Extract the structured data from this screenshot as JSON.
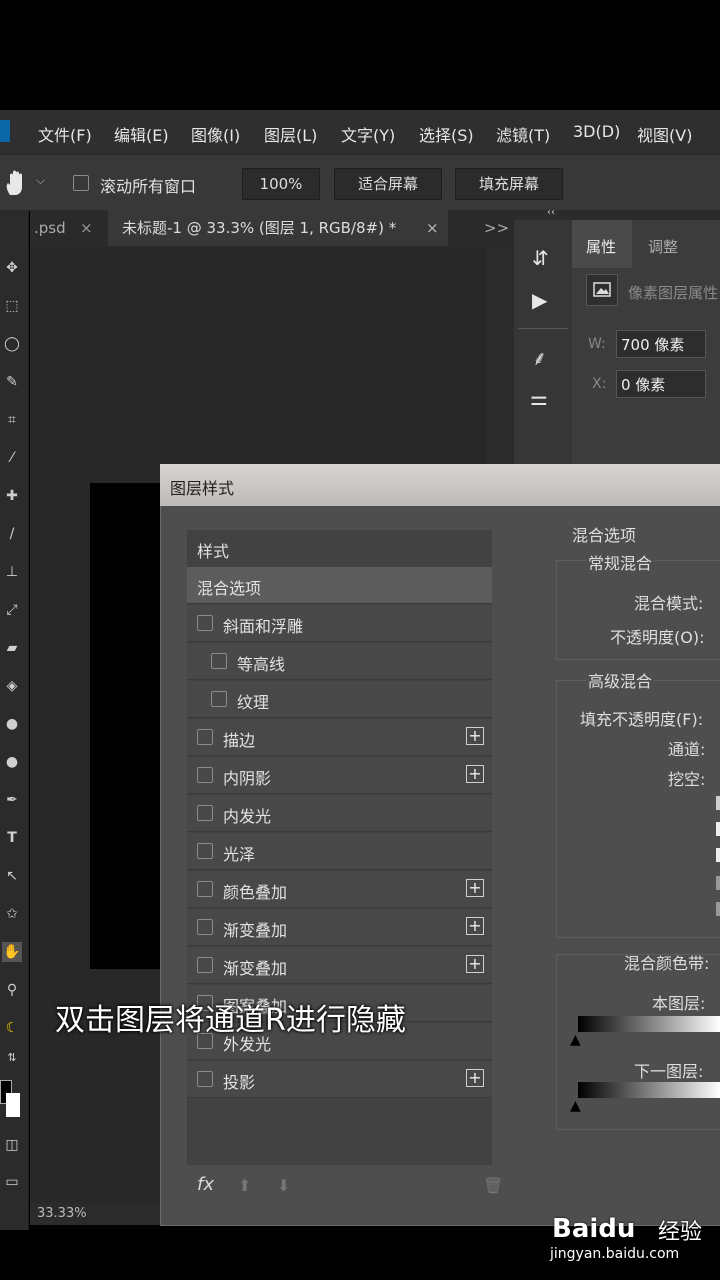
{
  "menu": [
    "文件(F)",
    "编辑(E)",
    "图像(I)",
    "图层(L)",
    "文字(Y)",
    "选择(S)",
    "滤镜(T)",
    "3D(D)",
    "视图(V)"
  ],
  "options": {
    "scroll_all": "滚动所有窗口",
    "zoom": "100%",
    "fit": "适合屏幕",
    "fill": "填充屏幕"
  },
  "tabs": {
    "prev": ".psd",
    "active": "未标题-1 @ 33.3% (图层 1, RGB/8#) *",
    "more": ">>"
  },
  "status": {
    "zoom": "33.33%"
  },
  "properties": {
    "tab_props": "属性",
    "tab_adjust": "调整",
    "pixel_layer": "像素图层属性",
    "w_label": "W:",
    "w_value": "700 像素",
    "x_label": "X:",
    "x_value": "0 像素"
  },
  "dialog": {
    "title": "图层样式",
    "styles_header": "样式",
    "items": [
      {
        "label": "混合选项",
        "checkbox": false,
        "plus": false,
        "selected": true,
        "indent": false
      },
      {
        "label": "斜面和浮雕",
        "checkbox": true,
        "plus": false,
        "indent": false
      },
      {
        "label": "等高线",
        "checkbox": true,
        "plus": false,
        "indent": true
      },
      {
        "label": "纹理",
        "checkbox": true,
        "plus": false,
        "indent": true
      },
      {
        "label": "描边",
        "checkbox": true,
        "plus": true,
        "indent": false
      },
      {
        "label": "内阴影",
        "checkbox": true,
        "plus": true,
        "indent": false
      },
      {
        "label": "内发光",
        "checkbox": true,
        "plus": false,
        "indent": false
      },
      {
        "label": "光泽",
        "checkbox": true,
        "plus": false,
        "indent": false
      },
      {
        "label": "颜色叠加",
        "checkbox": true,
        "plus": true,
        "indent": false
      },
      {
        "label": "渐变叠加",
        "checkbox": true,
        "plus": true,
        "indent": false
      },
      {
        "label": "渐变叠加",
        "checkbox": true,
        "plus": true,
        "indent": false
      },
      {
        "label": "图案叠加",
        "checkbox": true,
        "plus": false,
        "indent": false
      },
      {
        "label": "外发光",
        "checkbox": true,
        "plus": false,
        "indent": false
      },
      {
        "label": "投影",
        "checkbox": true,
        "plus": true,
        "indent": false
      }
    ],
    "fx": "fx",
    "blend": {
      "section": "混合选项",
      "general": "常规混合",
      "mode": "混合模式:",
      "opacity": "不透明度(O):",
      "advanced": "高级混合",
      "fill_opacity": "填充不透明度(F):",
      "channels": "通道:",
      "knockout": "挖空:",
      "blend_if": "混合颜色带:",
      "this_layer": "本图层:",
      "underlying": "下一图层:"
    }
  },
  "caption": "双击图层将通道R进行隐藏",
  "watermark": {
    "brand": "Baidu",
    "brand_cn": "经验",
    "url": "jingyan.baidu.com"
  }
}
